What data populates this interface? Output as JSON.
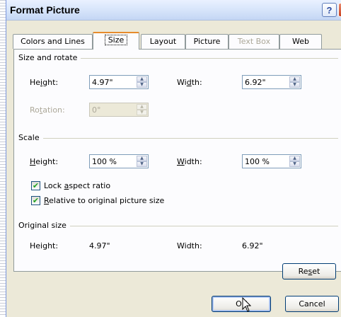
{
  "window": {
    "title": "Format Picture"
  },
  "titlebar": {
    "help_glyph": "?",
    "close_glyph": "✕"
  },
  "tabs": [
    {
      "label": "Colors and Lines",
      "state": "normal"
    },
    {
      "label": "Size",
      "state": "active"
    },
    {
      "label": "Layout",
      "state": "normal"
    },
    {
      "label": "Picture",
      "state": "normal"
    },
    {
      "label": "Text Box",
      "state": "disabled"
    },
    {
      "label": "Web",
      "state": "normal"
    }
  ],
  "size_rotate": {
    "header": "Size and rotate",
    "height_label_pre": "He",
    "height_label_ul": "i",
    "height_label_post": "ght:",
    "height_value": "4.97\"",
    "width_label_pre": "Wi",
    "width_label_ul": "d",
    "width_label_post": "th:",
    "width_value": "6.92\"",
    "rotation_label_pre": "Ro",
    "rotation_label_ul": "t",
    "rotation_label_post": "ation:",
    "rotation_value": "0°"
  },
  "scale": {
    "header": "Scale",
    "height_label_pre": "",
    "height_label_ul": "H",
    "height_label_post": "eight:",
    "height_value": "100 %",
    "width_label_pre": "",
    "width_label_ul": "W",
    "width_label_post": "idth:",
    "width_value": "100 %",
    "lock_pre": "Lock ",
    "lock_ul": "a",
    "lock_post": "spect ratio",
    "lock_checked": true,
    "relative_pre": "",
    "relative_ul": "R",
    "relative_post": "elative to original picture size",
    "relative_checked": true,
    "check_glyph": "✔"
  },
  "original_size": {
    "header": "Original size",
    "height_label": "Height:",
    "height_value": "4.97\"",
    "width_label": "Width:",
    "width_value": "6.92\""
  },
  "buttons": {
    "reset_pre": "Re",
    "reset_ul": "s",
    "reset_post": "et",
    "ok_label": "OK",
    "cancel_label": "Cancel"
  },
  "spin_glyphs": {
    "up": "▲",
    "down": "▼"
  },
  "colors": {
    "accent_tab": "#e68b2c",
    "dialog_face": "#ece9d8",
    "panel_face": "#fcfcfe"
  }
}
